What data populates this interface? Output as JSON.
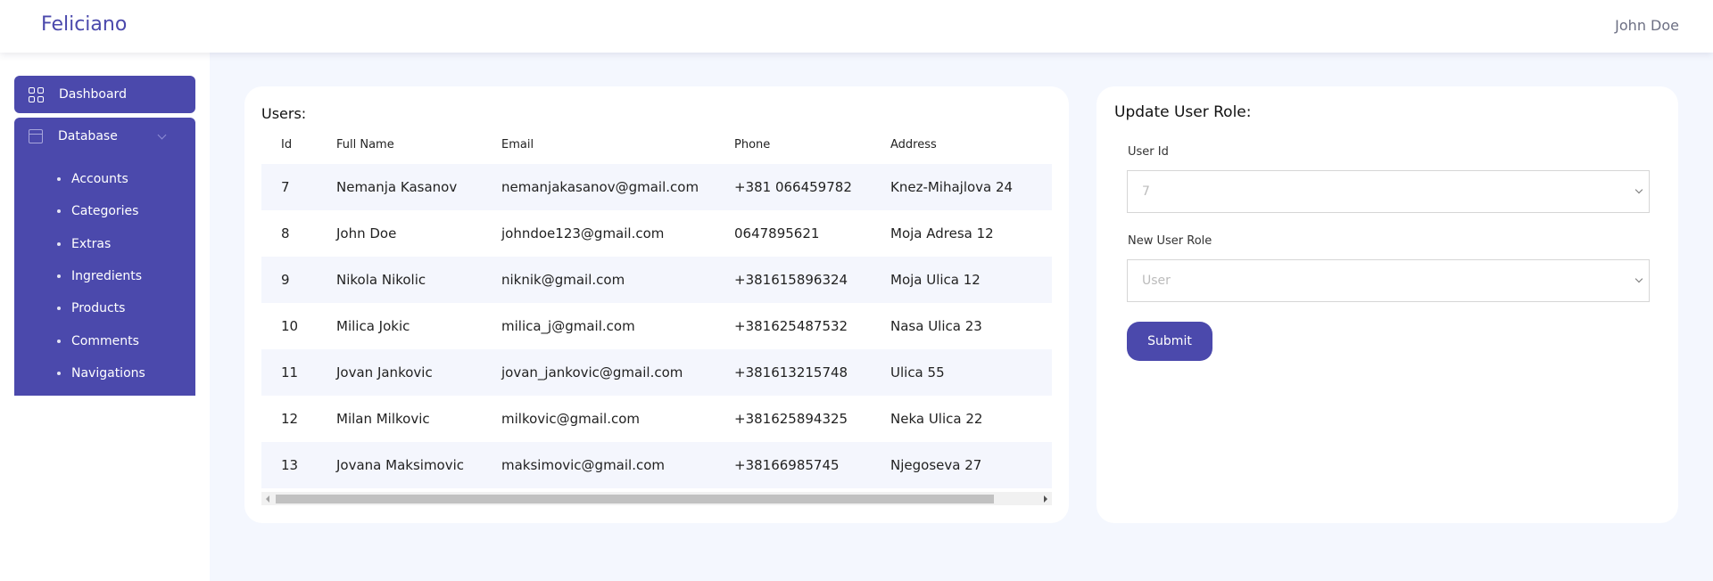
{
  "header": {
    "brand": "Feliciano",
    "user": "John Doe"
  },
  "sidebar": {
    "dashboard": "Dashboard",
    "database": "Database",
    "items": [
      "Accounts",
      "Categories",
      "Extras",
      "Ingredients",
      "Products",
      "Comments",
      "Navigations"
    ]
  },
  "users": {
    "title": "Users:",
    "columns": [
      "Id",
      "Full Name",
      "Email",
      "Phone",
      "Address"
    ],
    "rows": [
      [
        "7",
        "Nemanja Kasanov",
        "nemanjakasanov@gmail.com",
        "+381 066459782",
        "Knez-Mihajlova 24"
      ],
      [
        "8",
        "John Doe",
        "johndoe123@gmail.com",
        "0647895621",
        "Moja Adresa 12"
      ],
      [
        "9",
        "Nikola Nikolic",
        "niknik@gmail.com",
        "+381615896324",
        "Moja Ulica 12"
      ],
      [
        "10",
        "Milica Jokic",
        "milica_j@gmail.com",
        "+381625487532",
        "Nasa Ulica 23"
      ],
      [
        "11",
        "Jovan Jankovic",
        "jovan_jankovic@gmail.com",
        "+381613215748",
        "Ulica 55"
      ],
      [
        "12",
        "Milan Milkovic",
        "milkovic@gmail.com",
        "+381625894325",
        "Neka Ulica 22"
      ],
      [
        "13",
        "Jovana Maksimovic",
        "maksimovic@gmail.com",
        "+38166985745",
        "Njegoseva 27"
      ]
    ]
  },
  "role_form": {
    "title": "Update User Role:",
    "user_id_label": "User Id",
    "user_id_value": "7",
    "role_label": "New User Role",
    "role_value": "User",
    "submit": "Submit"
  }
}
